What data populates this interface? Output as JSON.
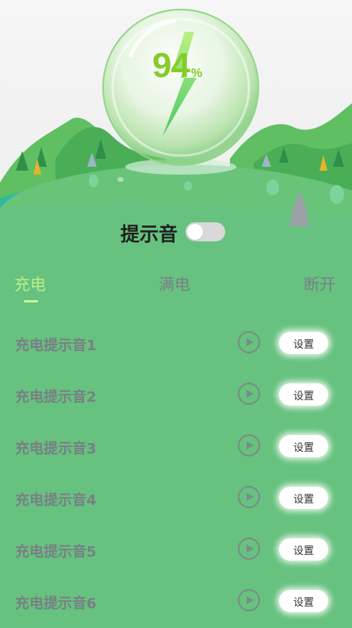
{
  "battery": {
    "percent_value": "94",
    "percent_sign": "%"
  },
  "sound": {
    "label": "提示音",
    "enabled": false
  },
  "tabs": [
    {
      "label": "充电",
      "active": true
    },
    {
      "label": "满电",
      "active": false
    },
    {
      "label": "断开",
      "active": false
    }
  ],
  "list": {
    "set_label": "设置",
    "items": [
      {
        "label": "充电提示音1"
      },
      {
        "label": "充电提示音2"
      },
      {
        "label": "充电提示音3"
      },
      {
        "label": "充电提示音4"
      },
      {
        "label": "充电提示音5"
      },
      {
        "label": "充电提示音6"
      }
    ]
  },
  "colors": {
    "background": "#66c27e",
    "active_tab": "#b9ef8d",
    "inactive_text": "#7a7f86",
    "percent": "#86cc2a"
  },
  "icons": [
    "lightning-icon",
    "play-icon"
  ]
}
